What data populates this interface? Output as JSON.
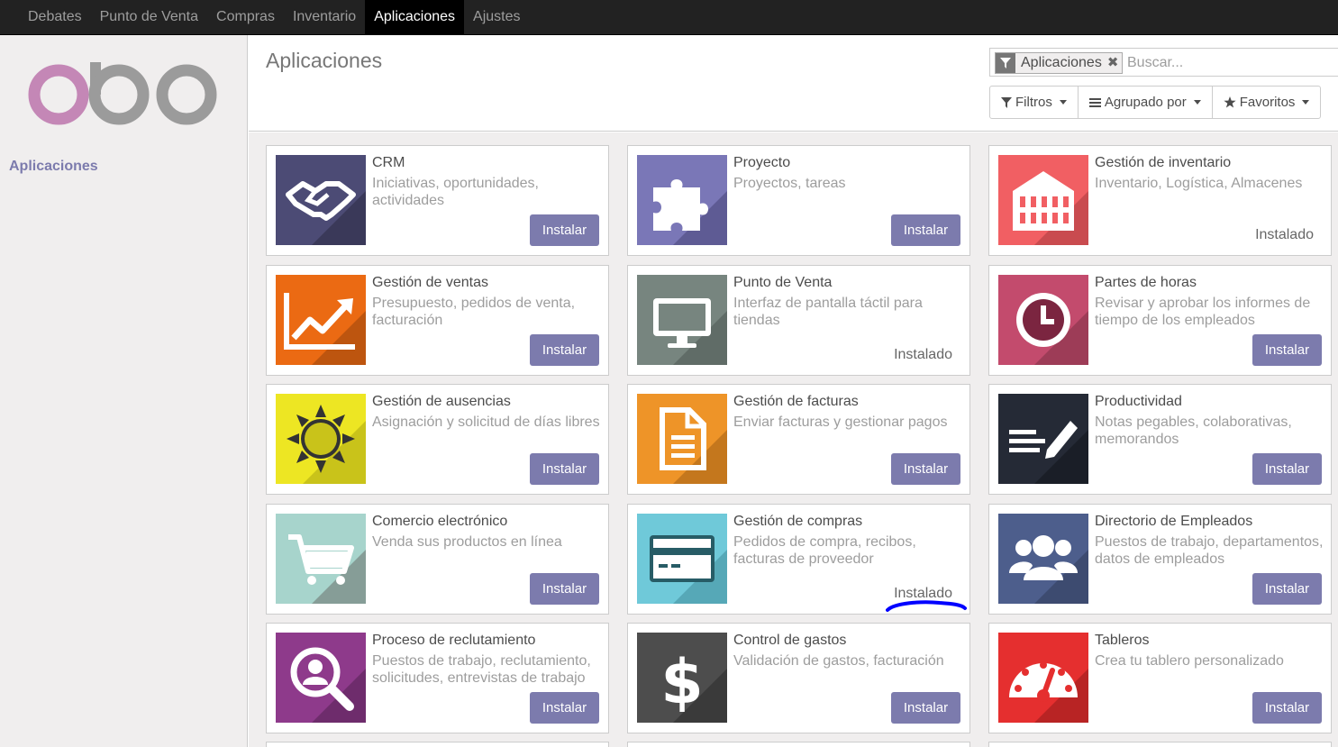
{
  "menu": {
    "items": [
      {
        "label": "Debates",
        "active": false
      },
      {
        "label": "Punto de Venta",
        "active": false
      },
      {
        "label": "Compras",
        "active": false
      },
      {
        "label": "Inventario",
        "active": false
      },
      {
        "label": "Aplicaciones",
        "active": true
      },
      {
        "label": "Ajustes",
        "active": false
      }
    ]
  },
  "sidebar": {
    "logo_text": "odoo",
    "link_label": "Aplicaciones"
  },
  "control_panel": {
    "title": "Aplicaciones",
    "facet_label": "Aplicaciones",
    "facet_remove": "✖",
    "search_placeholder": "Buscar...",
    "filters_label": "Filtros",
    "groupby_label": "Agrupado por",
    "favorites_label": "Favoritos"
  },
  "colors": {
    "accent": "#7c7bad",
    "topbar": "#222222",
    "annotation": "#0000ff"
  },
  "apps": [
    {
      "name": "CRM",
      "summary": "Iniciativas, oportunidades, actividades",
      "status": "install",
      "icon": "handshake-icon",
      "color": "#4c4b75"
    },
    {
      "name": "Proyecto",
      "summary": "Proyectos, tareas",
      "status": "install",
      "icon": "puzzle-icon",
      "color": "#7a77b7"
    },
    {
      "name": "Gestión de inventario",
      "summary": "Inventario, Logística, Almacenes",
      "status": "installed",
      "icon": "warehouse-icon",
      "color": "#f15f63"
    },
    {
      "name": "Gestión de ventas",
      "summary": "Presupuesto, pedidos de venta, facturación",
      "status": "install",
      "icon": "trend-chart-icon",
      "color": "#eb6a13"
    },
    {
      "name": "Punto de Venta",
      "summary": "Interfaz de pantalla táctil para tiendas",
      "status": "installed",
      "icon": "monitor-icon",
      "color": "#77857f"
    },
    {
      "name": "Partes de horas",
      "summary": "Revisar y aprobar los informes de tiempo de los empleados",
      "status": "install",
      "icon": "clock-icon",
      "color": "#c34b6d"
    },
    {
      "name": "Gestión de ausencias",
      "summary": "Asignación y solicitud de días libres",
      "status": "install",
      "icon": "sun-icon",
      "color": "#ede623"
    },
    {
      "name": "Gestión de facturas",
      "summary": "Enviar facturas y gestionar pagos",
      "status": "install",
      "icon": "document-icon",
      "color": "#ee9428"
    },
    {
      "name": "Productividad",
      "summary": "Notas pegables, colaborativas, memorandos",
      "status": "install",
      "icon": "notes-pencil-icon",
      "color": "#252a36"
    },
    {
      "name": "Comercio electrónico",
      "summary": "Venda sus productos en línea",
      "status": "install",
      "icon": "cart-icon",
      "color": "#a7d4cc"
    },
    {
      "name": "Gestión de compras",
      "summary": "Pedidos de compra, recibos, facturas de proveedor",
      "status": "installed",
      "icon": "credit-card-icon",
      "color": "#6fc9d9"
    },
    {
      "name": "Directorio de Empleados",
      "summary": "Puestos de trabajo, departamentos, datos de empleados",
      "status": "install",
      "icon": "people-icon",
      "color": "#4d5e8c"
    },
    {
      "name": "Proceso de reclutamiento",
      "summary": "Puestos de trabajo, reclutamiento, solicitudes, entrevistas de trabajo",
      "status": "install",
      "icon": "magnifier-person-icon",
      "color": "#8e3a8b"
    },
    {
      "name": "Control de gastos",
      "summary": "Validación de gastos, facturación",
      "status": "install",
      "icon": "dollar-icon",
      "color": "#4d4d4d"
    },
    {
      "name": "Tableros",
      "summary": "Crea tu tablero personalizado",
      "status": "install",
      "icon": "gauge-icon",
      "color": "#e52f2f"
    }
  ],
  "labels": {
    "install": "Instalar",
    "installed": "Instalado"
  }
}
